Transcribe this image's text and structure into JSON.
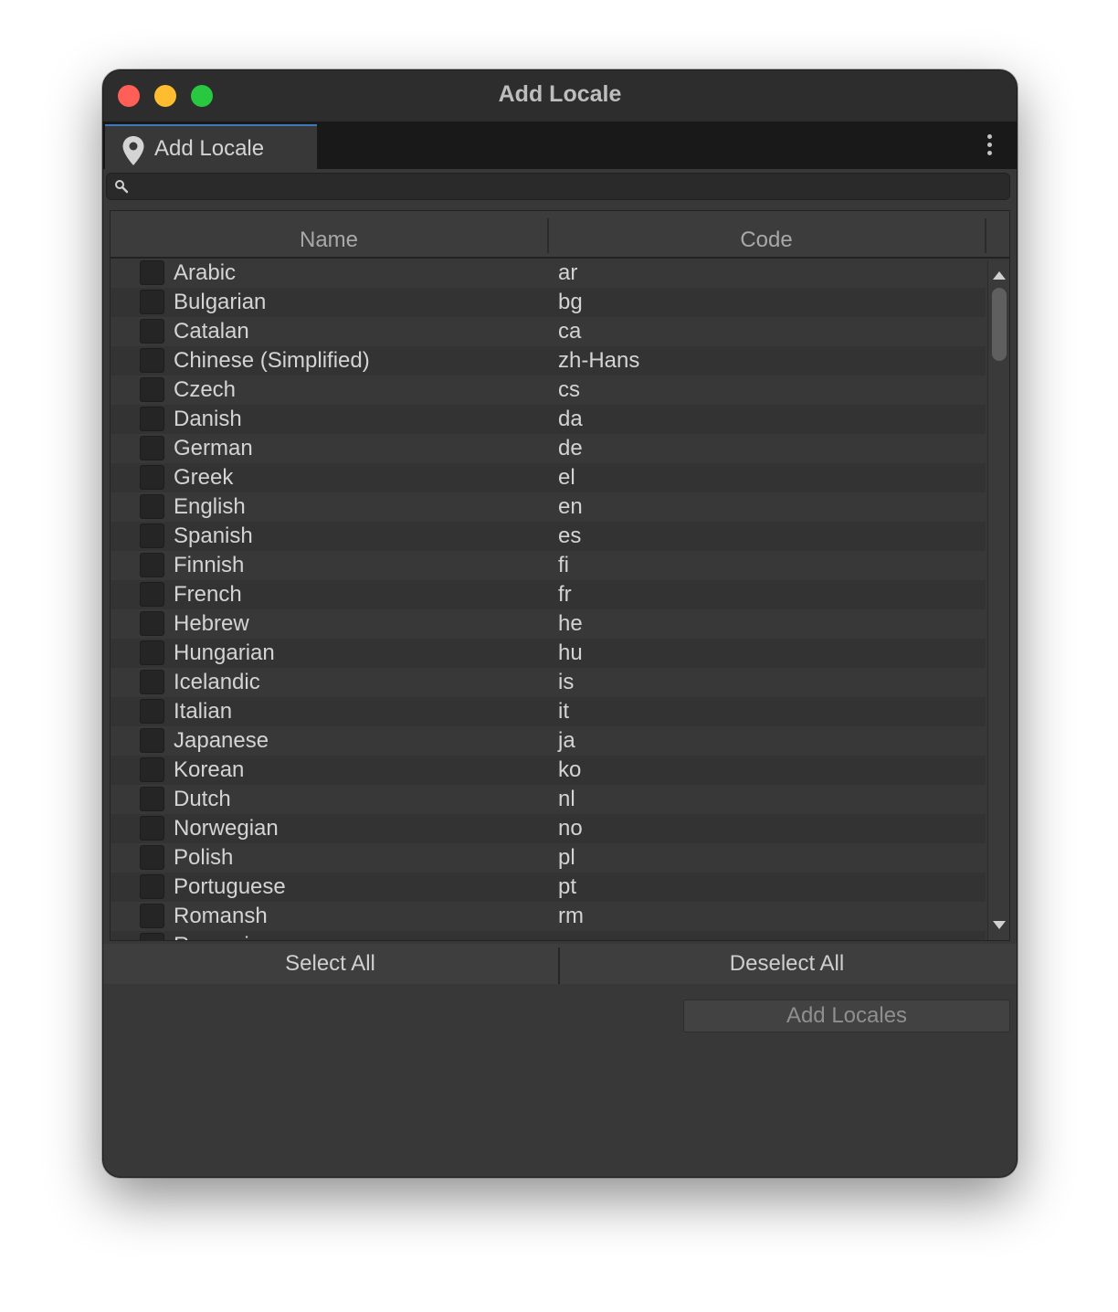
{
  "window": {
    "title": "Add Locale"
  },
  "tab": {
    "label": "Add Locale",
    "icon": "location-pin-icon"
  },
  "search": {
    "value": "",
    "placeholder": "",
    "icon": "search-icon"
  },
  "table": {
    "columns": [
      "Name",
      "Code"
    ],
    "rows": [
      {
        "name": "Arabic",
        "code": "ar",
        "checked": false
      },
      {
        "name": "Bulgarian",
        "code": "bg",
        "checked": false
      },
      {
        "name": "Catalan",
        "code": "ca",
        "checked": false
      },
      {
        "name": "Chinese (Simplified)",
        "code": "zh-Hans",
        "checked": false
      },
      {
        "name": "Czech",
        "code": "cs",
        "checked": false
      },
      {
        "name": "Danish",
        "code": "da",
        "checked": false
      },
      {
        "name": "German",
        "code": "de",
        "checked": false
      },
      {
        "name": "Greek",
        "code": "el",
        "checked": false
      },
      {
        "name": "English",
        "code": "en",
        "checked": false
      },
      {
        "name": "Spanish",
        "code": "es",
        "checked": false
      },
      {
        "name": "Finnish",
        "code": "fi",
        "checked": false
      },
      {
        "name": "French",
        "code": "fr",
        "checked": false
      },
      {
        "name": "Hebrew",
        "code": "he",
        "checked": false
      },
      {
        "name": "Hungarian",
        "code": "hu",
        "checked": false
      },
      {
        "name": "Icelandic",
        "code": "is",
        "checked": false
      },
      {
        "name": "Italian",
        "code": "it",
        "checked": false
      },
      {
        "name": "Japanese",
        "code": "ja",
        "checked": false
      },
      {
        "name": "Korean",
        "code": "ko",
        "checked": false
      },
      {
        "name": "Dutch",
        "code": "nl",
        "checked": false
      },
      {
        "name": "Norwegian",
        "code": "no",
        "checked": false
      },
      {
        "name": "Polish",
        "code": "pl",
        "checked": false
      },
      {
        "name": "Portuguese",
        "code": "pt",
        "checked": false
      },
      {
        "name": "Romansh",
        "code": "rm",
        "checked": false
      },
      {
        "name": "Romanian",
        "code": "ro",
        "checked": false
      }
    ]
  },
  "buttons": {
    "select_all": "Select All",
    "deselect_all": "Deselect All",
    "add_locales": "Add Locales"
  },
  "colors": {
    "traffic_red": "#ff5f57",
    "traffic_yellow": "#febc2e",
    "traffic_green": "#28c840",
    "tab_accent": "#3a79bb"
  }
}
